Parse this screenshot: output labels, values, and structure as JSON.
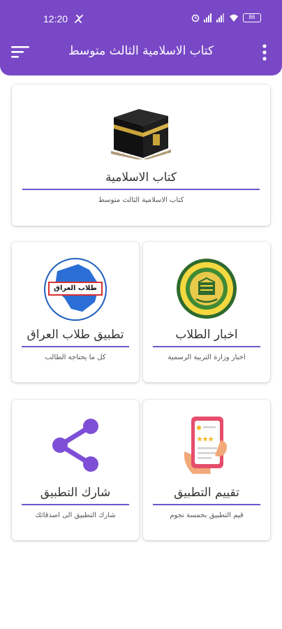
{
  "status_bar": {
    "time": "12:20",
    "battery": "86"
  },
  "app_bar": {
    "title": "كتاب الاسلامية الثالث متوسط"
  },
  "cards": {
    "book": {
      "title": "كتاب الاسلامية",
      "subtitle": "كتاب الاسلامية الثالث متوسط",
      "icon": "kaaba-icon"
    },
    "news": {
      "title": "اخبار الطلاب",
      "subtitle": "اخبار وزارة التربية الرسمية",
      "icon": "ministry-logo-icon"
    },
    "students": {
      "title": "تطبيق طلاب العراق",
      "subtitle": "كل ما يحتاجة الطالب",
      "icon": "iraq-students-logo-icon",
      "logo_text": "طلاب العراق"
    },
    "rate": {
      "title": "تقييم التطبيق",
      "subtitle": "قيم التطبيق بخمسة نجوم",
      "icon": "rating-phone-icon"
    },
    "share": {
      "title": "شارك التطبيق",
      "subtitle": "شارك التطبيق الى اصدقائك",
      "icon": "share-icon"
    }
  },
  "colors": {
    "primary": "#7848c6",
    "divider": "#6a58c8",
    "share_purple": "#7e4fd6"
  }
}
